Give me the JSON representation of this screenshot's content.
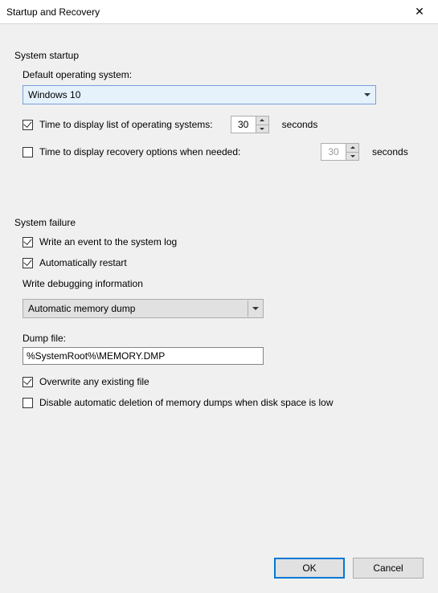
{
  "titlebar": {
    "title": "Startup and Recovery"
  },
  "startup": {
    "title": "System startup",
    "default_os_label": "Default operating system:",
    "default_os_value": "Windows 10",
    "time_os_list": {
      "checked": true,
      "label": "Time to display list of operating systems:",
      "value": "30",
      "unit": "seconds"
    },
    "time_recovery": {
      "checked": false,
      "label": "Time to display recovery options when needed:",
      "value": "30",
      "unit": "seconds"
    }
  },
  "failure": {
    "title": "System failure",
    "write_event": {
      "checked": true,
      "label": "Write an event to the system log"
    },
    "auto_restart": {
      "checked": true,
      "label": "Automatically restart"
    },
    "write_debug_title": "Write debugging information",
    "debug_type": "Automatic memory dump",
    "dump_file_label": "Dump file:",
    "dump_file_value": "%SystemRoot%\\MEMORY.DMP",
    "overwrite": {
      "checked": true,
      "label": "Overwrite any existing file"
    },
    "disable_delete": {
      "checked": false,
      "label": "Disable automatic deletion of memory dumps when disk space is low"
    }
  },
  "buttons": {
    "ok": "OK",
    "cancel": "Cancel"
  }
}
